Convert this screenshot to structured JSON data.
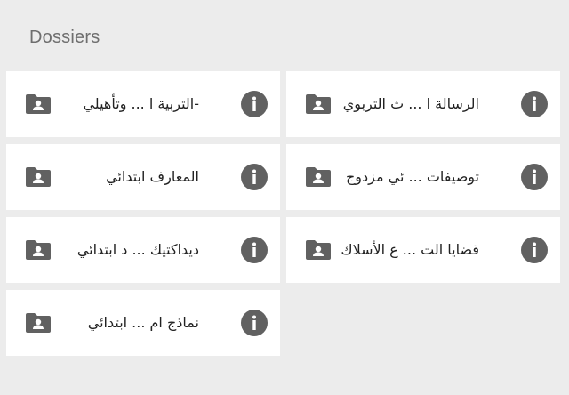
{
  "section": {
    "title": "Dossiers"
  },
  "folders": [
    {
      "label": "الرسالة ا ... ث التربوي"
    },
    {
      "label": "-التربية ا ... وتأهيلي"
    },
    {
      "label": "توصيفات ... ئي مزدوج"
    },
    {
      "label": "المعارف ابتدائي"
    },
    {
      "label": "قضايا الت ... ع الأسلاك"
    },
    {
      "label": "ديداكتيك ... د ابتدائي"
    },
    {
      "label": "نماذج ام ... ابتدائي"
    }
  ],
  "icons": {
    "folder": "shared-folder-icon",
    "info": "info-icon"
  },
  "colors": {
    "background": "#ececec",
    "card": "#ffffff",
    "icon": "#616161"
  }
}
